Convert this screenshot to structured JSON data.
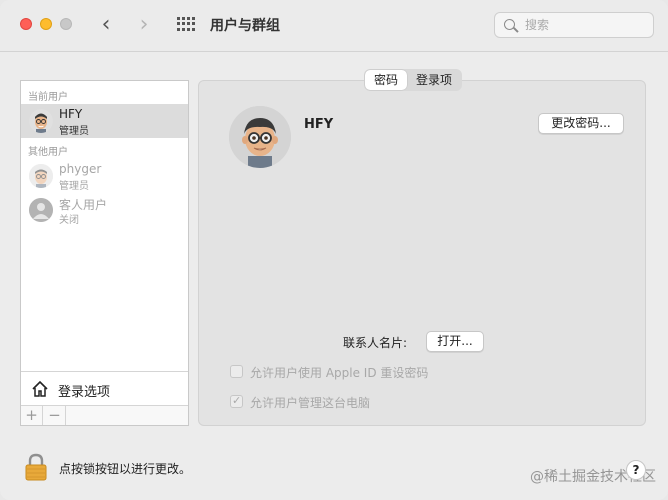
{
  "window": {
    "title": "用户与群组",
    "nav_back": "‹",
    "nav_forward": "›"
  },
  "search": {
    "placeholder": "搜索",
    "value": ""
  },
  "sidebar": {
    "current_users_label": "当前用户",
    "other_users_label": "其他用户",
    "current_user": {
      "name": "HFY",
      "role": "管理员"
    },
    "other_users": [
      {
        "name": "phyger",
        "role": "管理员"
      },
      {
        "name": "客人用户",
        "role": "关闭"
      }
    ],
    "login_options_label": "登录选项",
    "add_label": "+",
    "remove_label": "−"
  },
  "tabs": [
    {
      "label": "密码",
      "active": true
    },
    {
      "label": "登录项",
      "active": false
    }
  ],
  "profile": {
    "name": "HFY",
    "change_password_label": "更改密码...",
    "contact_card_label": "联系人名片:",
    "open_label": "打开..."
  },
  "options": [
    {
      "label": "允许用户使用 Apple ID 重设密码",
      "checked": false
    },
    {
      "label": "允许用户管理这台电脑",
      "checked": true
    }
  ],
  "footer": {
    "lock_text": "点按锁按钮以进行更改。",
    "help_label": "?",
    "watermark": "@稀土掘金技术社区"
  },
  "colors": {
    "close": "#ff5f57",
    "minimize": "#febc2e",
    "zoom": "#c8c8c8",
    "lock": "#e8a93a"
  }
}
